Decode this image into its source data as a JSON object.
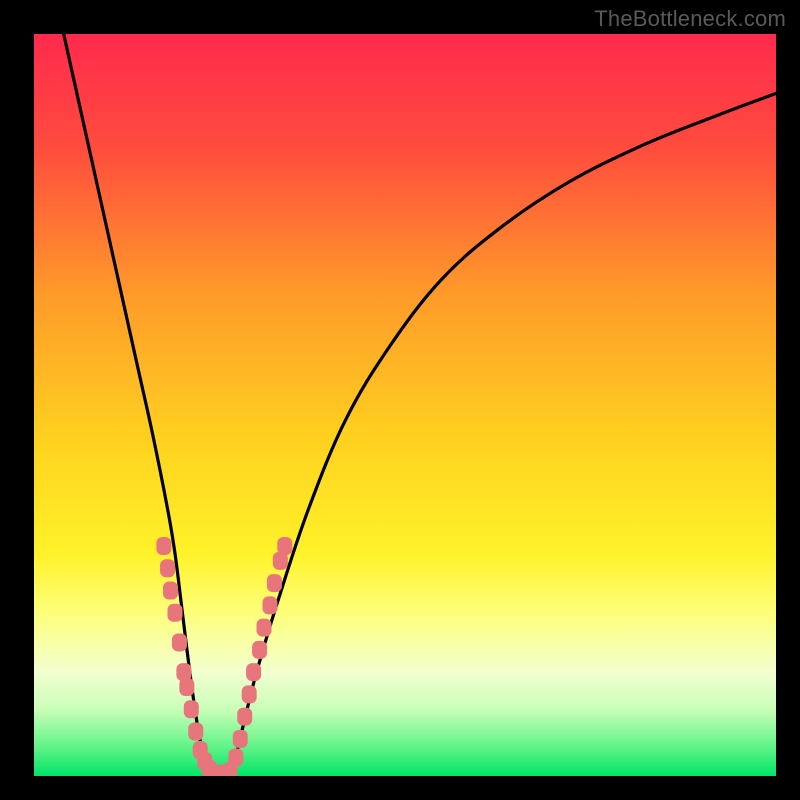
{
  "watermark": "TheBottleneck.com",
  "chart_data": {
    "type": "line",
    "title": "",
    "xlabel": "",
    "ylabel": "",
    "xlim": [
      0,
      100
    ],
    "ylim": [
      0,
      100
    ],
    "grid": false,
    "legend": false,
    "gradient_stops": [
      {
        "pos": 0.0,
        "color": "#ff2a4d"
      },
      {
        "pos": 0.15,
        "color": "#ff4b3e"
      },
      {
        "pos": 0.35,
        "color": "#ff9a2a"
      },
      {
        "pos": 0.55,
        "color": "#ffd21f"
      },
      {
        "pos": 0.7,
        "color": "#fff22a"
      },
      {
        "pos": 0.78,
        "color": "#fdff7a"
      },
      {
        "pos": 0.86,
        "color": "#f3ffd0"
      },
      {
        "pos": 0.91,
        "color": "#c9ffb8"
      },
      {
        "pos": 0.96,
        "color": "#62f488"
      },
      {
        "pos": 1.0,
        "color": "#00e468"
      }
    ],
    "series": [
      {
        "name": "bottleneck-curve",
        "color": "#000000",
        "x": [
          4,
          6,
          8,
          10,
          12,
          14,
          16,
          18,
          19,
          20,
          21,
          22,
          23,
          24,
          25,
          26,
          27,
          28,
          30,
          33,
          37,
          42,
          48,
          55,
          63,
          72,
          82,
          92,
          100
        ],
        "y": [
          100,
          91,
          82,
          73,
          64,
          55,
          46,
          36,
          30,
          22,
          14,
          7,
          2,
          0,
          0,
          0,
          2,
          6,
          14,
          24,
          36,
          48,
          58,
          67,
          74,
          80,
          85,
          89,
          92
        ]
      }
    ],
    "marker_clusters": [
      {
        "name": "left-cluster",
        "color": "#e9757c",
        "points": [
          {
            "x": 17.5,
            "y": 31
          },
          {
            "x": 18.0,
            "y": 28
          },
          {
            "x": 18.4,
            "y": 25
          },
          {
            "x": 19.0,
            "y": 22
          },
          {
            "x": 19.6,
            "y": 18
          },
          {
            "x": 20.2,
            "y": 14
          },
          {
            "x": 20.6,
            "y": 12
          },
          {
            "x": 21.2,
            "y": 9
          },
          {
            "x": 21.8,
            "y": 6
          },
          {
            "x": 22.4,
            "y": 3.5
          },
          {
            "x": 23.0,
            "y": 2
          },
          {
            "x": 23.6,
            "y": 1
          }
        ]
      },
      {
        "name": "bottom-cluster",
        "color": "#e9757c",
        "points": [
          {
            "x": 24.0,
            "y": 0.4
          },
          {
            "x": 24.6,
            "y": 0.3
          },
          {
            "x": 25.2,
            "y": 0.3
          },
          {
            "x": 25.8,
            "y": 0.4
          },
          {
            "x": 26.4,
            "y": 0.6
          }
        ]
      },
      {
        "name": "right-cluster",
        "color": "#e9757c",
        "points": [
          {
            "x": 27.2,
            "y": 2.5
          },
          {
            "x": 27.8,
            "y": 5
          },
          {
            "x": 28.4,
            "y": 8
          },
          {
            "x": 29.0,
            "y": 11
          },
          {
            "x": 29.6,
            "y": 14
          },
          {
            "x": 30.4,
            "y": 17
          },
          {
            "x": 31.0,
            "y": 20
          },
          {
            "x": 31.8,
            "y": 23
          },
          {
            "x": 32.4,
            "y": 26
          },
          {
            "x": 33.2,
            "y": 29
          },
          {
            "x": 33.8,
            "y": 31
          }
        ]
      }
    ]
  }
}
